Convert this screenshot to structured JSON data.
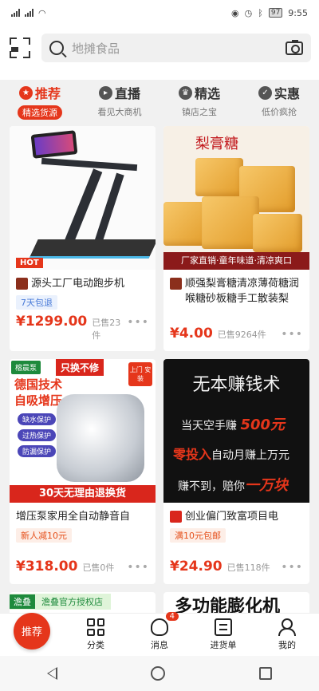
{
  "status": {
    "battery": "97",
    "time": "9:55"
  },
  "search": {
    "placeholder": "地摊食品"
  },
  "tabs": [
    {
      "label": "推荐",
      "sub": "精选货源",
      "icon": "star-icon"
    },
    {
      "label": "直播",
      "sub": "看见大商机",
      "icon": "live-icon"
    },
    {
      "label": "精选",
      "sub": "镇店之宝",
      "icon": "crown-icon"
    },
    {
      "label": "实惠",
      "sub": "低价疯抢",
      "icon": "discount-icon"
    }
  ],
  "products": [
    {
      "title": "源头工厂电动跑步机",
      "tag": "7天包退",
      "price": "¥1299.00",
      "sold": "已售23件",
      "badge": "HOT"
    },
    {
      "title": "顺强梨膏糖清凉薄荷糖润喉糖砂板糖手工散装梨",
      "price": "¥4.00",
      "sold": "已售9264件",
      "art_label": "梨膏糖",
      "art_banner": "厂家直销·童年味道·清凉爽口"
    },
    {
      "title": "增压泵家用全自动静音自",
      "tag": "新人减10元",
      "price": "¥318.00",
      "sold": "已售0件",
      "art_logo": "榕晨泵",
      "art_header": "只换不修",
      "art_big1": "德国技术",
      "art_big2": "自吸增压",
      "art_pills": [
        "缺水保护",
        "过热保护",
        "防漏保护"
      ],
      "art_service": "上门 安装",
      "art_banner": "30天无理由退换货"
    },
    {
      "title": "创业偏门致富项目电",
      "tag": "满10元包邮",
      "price": "¥24.90",
      "sold": "已售118件",
      "art_line1": "无本赚钱术",
      "art_line2a": "当天空手赚",
      "art_line2b": "500元",
      "art_line3a": "零投入",
      "art_line3b": "自动月赚上万元",
      "art_line4a": "赚不到，赔你",
      "art_line4b": "一万块"
    }
  ],
  "peek": {
    "store_badge": "澹叠",
    "store_text": "澹叠官方授权店",
    "right_text": "多功能膨化机"
  },
  "bottom_nav": [
    {
      "label": "推荐"
    },
    {
      "label": "分类"
    },
    {
      "label": "消息",
      "badge": "4"
    },
    {
      "label": "进货单"
    },
    {
      "label": "我的"
    }
  ]
}
